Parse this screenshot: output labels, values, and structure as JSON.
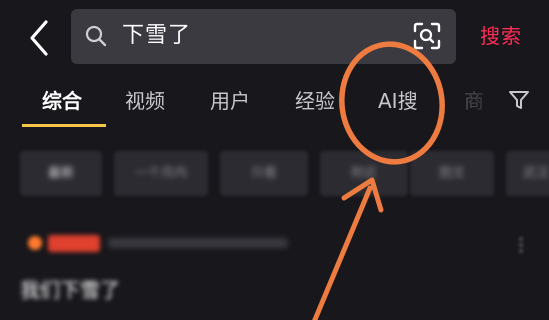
{
  "header": {
    "back_icon": "chevron-left-icon",
    "search_icon": "search-icon",
    "search_query": "下雪了",
    "scan_icon": "scan-icon",
    "search_button": "搜索",
    "accent_color": "#ff2d55"
  },
  "tabs": [
    {
      "label": "综合",
      "active": true
    },
    {
      "label": "视频",
      "active": false
    },
    {
      "label": "用户",
      "active": false
    },
    {
      "label": "经验",
      "active": false
    },
    {
      "label": "AI搜",
      "active": false
    },
    {
      "label": "商",
      "active": false
    }
  ],
  "filter_icon": "filter-icon",
  "tab_indicator_color": "#f7c548",
  "chips": [
    {
      "label": "最新"
    },
    {
      "label": "一个月内"
    },
    {
      "label": "只看"
    },
    {
      "label": "附近"
    },
    {
      "label": "图文"
    },
    {
      "label": "武汉"
    }
  ],
  "result": {
    "title": "我们下雪了"
  },
  "annotation_color": "#ee7b3f"
}
